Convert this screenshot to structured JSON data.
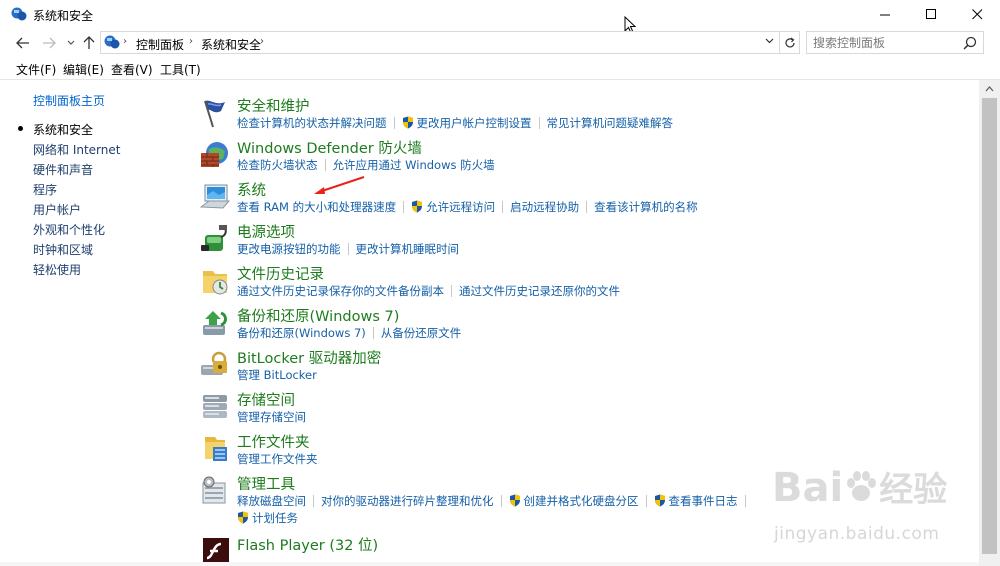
{
  "window": {
    "title": "系统和安全",
    "controls": {
      "minimize": "—",
      "maximize": "☐",
      "close": "✕"
    }
  },
  "address": {
    "crumbs": [
      "控制面板",
      "系统和安全"
    ],
    "search_placeholder": "搜索控制面板"
  },
  "menu": [
    "文件(F)",
    "编辑(E)",
    "查看(V)",
    "工具(T)"
  ],
  "sidebar": {
    "items": [
      {
        "label": "控制面板主页",
        "current": false
      },
      {
        "label": "系统和安全",
        "current": true
      },
      {
        "label": "网络和 Internet",
        "current": false
      },
      {
        "label": "硬件和声音",
        "current": false
      },
      {
        "label": "程序",
        "current": false
      },
      {
        "label": "用户帐户",
        "current": false
      },
      {
        "label": "外观和个性化",
        "current": false
      },
      {
        "label": "时钟和区域",
        "current": false
      },
      {
        "label": "轻松使用",
        "current": false
      }
    ]
  },
  "categories": [
    {
      "title": "安全和维护",
      "links": [
        {
          "text": "检查计算机的状态并解决问题",
          "shield": false
        },
        {
          "text": "更改用户帐户控制设置",
          "shield": true
        },
        {
          "text": "常见计算机问题疑难解答",
          "shield": false
        }
      ]
    },
    {
      "title": "Windows Defender 防火墙",
      "links": [
        {
          "text": "检查防火墙状态",
          "shield": false
        },
        {
          "text": "允许应用通过 Windows 防火墙",
          "shield": false
        }
      ]
    },
    {
      "title": "系统",
      "links": [
        {
          "text": "查看 RAM 的大小和处理器速度",
          "shield": false
        },
        {
          "text": "允许远程访问",
          "shield": true
        },
        {
          "text": "启动远程协助",
          "shield": false
        },
        {
          "text": "查看该计算机的名称",
          "shield": false
        }
      ]
    },
    {
      "title": "电源选项",
      "links": [
        {
          "text": "更改电源按钮的功能",
          "shield": false
        },
        {
          "text": "更改计算机睡眠时间",
          "shield": false
        }
      ]
    },
    {
      "title": "文件历史记录",
      "links": [
        {
          "text": "通过文件历史记录保存你的文件备份副本",
          "shield": false
        },
        {
          "text": "通过文件历史记录还原你的文件",
          "shield": false
        }
      ]
    },
    {
      "title": "备份和还原(Windows 7)",
      "links": [
        {
          "text": "备份和还原(Windows 7)",
          "shield": false
        },
        {
          "text": "从备份还原文件",
          "shield": false
        }
      ]
    },
    {
      "title": "BitLocker 驱动器加密",
      "links": [
        {
          "text": "管理 BitLocker",
          "shield": false
        }
      ]
    },
    {
      "title": "存储空间",
      "links": [
        {
          "text": "管理存储空间",
          "shield": false
        }
      ]
    },
    {
      "title": "工作文件夹",
      "links": [
        {
          "text": "管理工作文件夹",
          "shield": false
        }
      ]
    },
    {
      "title": "管理工具",
      "links": [
        {
          "text": "释放磁盘空间",
          "shield": false
        },
        {
          "text": "对你的驱动器进行碎片整理和优化",
          "shield": false
        },
        {
          "text": "创建并格式化硬盘分区",
          "shield": true
        },
        {
          "text": "查看事件日志",
          "shield": true
        }
      ],
      "links2": [
        {
          "text": "计划任务",
          "shield": true
        }
      ]
    },
    {
      "title": "Flash Player (32 位)",
      "links": []
    }
  ],
  "watermark": {
    "logo": "Bai",
    "logo_cn": "经验",
    "url": "jingyan.baidu.com"
  }
}
